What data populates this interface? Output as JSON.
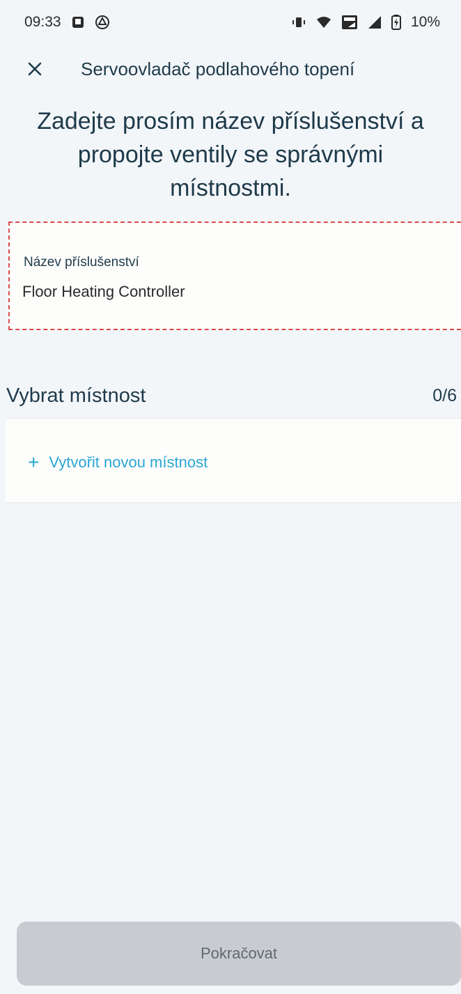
{
  "status_bar": {
    "time": "09:33",
    "battery": "10%",
    "icons": [
      "notification-icon",
      "drive-icon",
      "vibrate-icon",
      "wifi-icon",
      "volte-icon",
      "signal-icon",
      "battery-icon"
    ]
  },
  "header": {
    "close_icon": "close-icon",
    "title": "Servoovladač podlahového topení"
  },
  "instruction": "Zadejte prosím název příslušenství a propojte ventily se správnými místnostmi.",
  "accessory": {
    "label": "Název příslušenství",
    "value": "Floor Heating Controller"
  },
  "rooms": {
    "title": "Vybrat místnost",
    "count": "0/6",
    "create_label": "Vytvořit novou místnost",
    "create_icon": "plus-icon"
  },
  "footer": {
    "continue_label": "Pokračovat"
  },
  "colors": {
    "background": "#f3f6f9",
    "primary_text": "#1e3a4a",
    "link": "#2aa6d4",
    "disabled_button": "#c8ccd0",
    "highlight_border": "#d84a4a"
  }
}
